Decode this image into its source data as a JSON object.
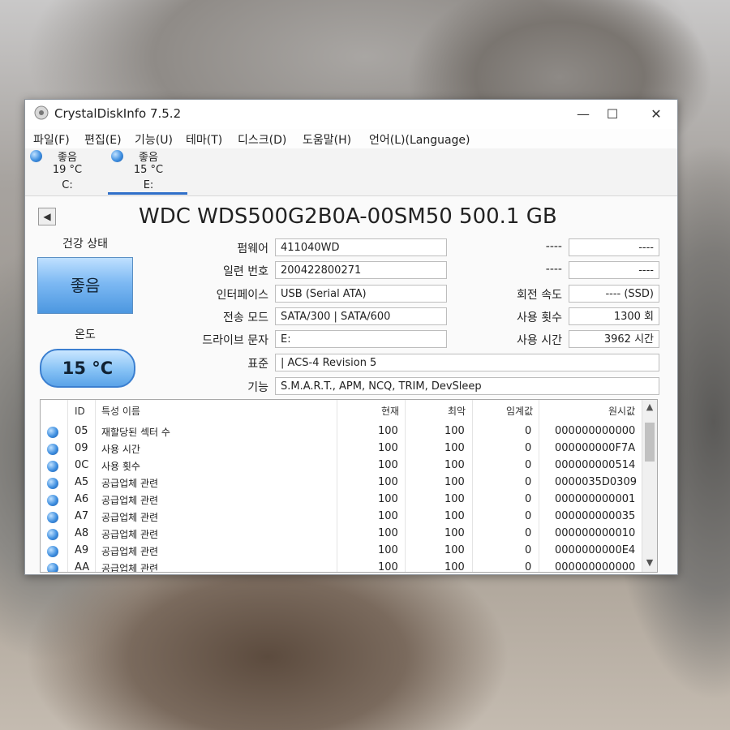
{
  "window": {
    "title": "CrystalDiskInfo 7.5.2",
    "minimize": "—",
    "maximize": "☐",
    "close": "✕"
  },
  "menu": [
    "파일(F)",
    "편집(E)",
    "기능(U)",
    "테마(T)",
    "디스크(D)",
    "도움말(H)",
    "언어(L)(Language)"
  ],
  "disks": [
    {
      "status": "좋음",
      "temp": "19 °C",
      "drive": "C:"
    },
    {
      "status": "좋음",
      "temp": "15 °C",
      "drive": "E:"
    }
  ],
  "model": "WDC  WDS500G2B0A-00SM50 500.1 GB",
  "health": {
    "label": "건강 상태",
    "value": "좋음"
  },
  "temperature": {
    "label": "온도",
    "value": "15 °C"
  },
  "info": {
    "firmware_label": "펌웨어",
    "firmware": "411040WD",
    "serial_label": "일련 번호",
    "serial": "200422800271",
    "interface_label": "인터페이스",
    "interface": "USB (Serial ATA)",
    "transfer_label": "전송 모드",
    "transfer": "SATA/300 | SATA/600",
    "drive_letter_label": "드라이브 문자",
    "drive_letter": "E:",
    "standard_label": "표준",
    "standard": "| ACS-4 Revision 5",
    "features_label": "기능",
    "features": "S.M.A.R.T., APM, NCQ, TRIM, DevSleep",
    "blank_label_1": "----",
    "blank_value_1": "----",
    "blank_label_2": "----",
    "blank_value_2": "----",
    "rotation_label": "회전 속도",
    "rotation": "---- (SSD)",
    "power_count_label": "사용 횟수",
    "power_count": "1300 회",
    "power_hours_label": "사용 시간",
    "power_hours": "3962 시간"
  },
  "smart": {
    "headers": {
      "id": "ID",
      "name": "특성 이름",
      "current": "현재",
      "worst": "최악",
      "threshold": "임계값",
      "raw": "원시값"
    },
    "rows": [
      {
        "id": "05",
        "name": "재할당된 섹터 수",
        "current": "100",
        "worst": "100",
        "threshold": "0",
        "raw": "000000000000"
      },
      {
        "id": "09",
        "name": "사용 시간",
        "current": "100",
        "worst": "100",
        "threshold": "0",
        "raw": "000000000F7A"
      },
      {
        "id": "0C",
        "name": "사용 횟수",
        "current": "100",
        "worst": "100",
        "threshold": "0",
        "raw": "000000000514"
      },
      {
        "id": "A5",
        "name": "공급업체 관련",
        "current": "100",
        "worst": "100",
        "threshold": "0",
        "raw": "0000035D0309"
      },
      {
        "id": "A6",
        "name": "공급업체 관련",
        "current": "100",
        "worst": "100",
        "threshold": "0",
        "raw": "000000000001"
      },
      {
        "id": "A7",
        "name": "공급업체 관련",
        "current": "100",
        "worst": "100",
        "threshold": "0",
        "raw": "000000000035"
      },
      {
        "id": "A8",
        "name": "공급업체 관련",
        "current": "100",
        "worst": "100",
        "threshold": "0",
        "raw": "000000000010"
      },
      {
        "id": "A9",
        "name": "공급업체 관련",
        "current": "100",
        "worst": "100",
        "threshold": "0",
        "raw": "0000000000E4"
      },
      {
        "id": "AA",
        "name": "공급업체 관련",
        "current": "100",
        "worst": "100",
        "threshold": "0",
        "raw": "000000000000"
      }
    ]
  }
}
